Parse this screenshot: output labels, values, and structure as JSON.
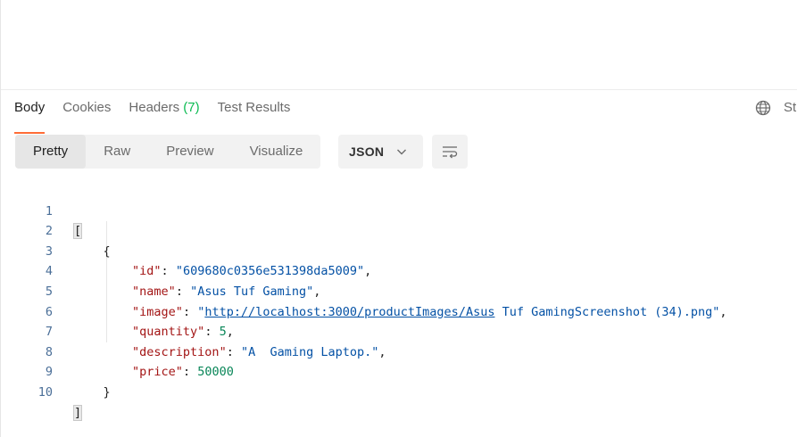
{
  "response_tabs": [
    {
      "label": "Body"
    },
    {
      "label": "Cookies"
    },
    {
      "label": "Headers",
      "count": "(7)"
    },
    {
      "label": "Test Results"
    }
  ],
  "status_cut": "St",
  "view_modes": [
    "Pretty",
    "Raw",
    "Preview",
    "Visualize"
  ],
  "format": "JSON",
  "colors": {
    "active_tab_underline": "#ff6c37",
    "headers_count": "#0cbb52",
    "json_key": "#a31515",
    "json_string": "#0451a5",
    "json_number": "#098658"
  },
  "icons": {
    "globe": "globe-icon",
    "format_dropdown": "chevron-down-icon",
    "wrap": "wrap-lines-icon"
  },
  "code": {
    "line_numbers": [
      "1",
      "2",
      "3",
      "4",
      "5",
      "6",
      "7",
      "8",
      "9",
      "10"
    ],
    "open_bracket": "[",
    "open_brace": "{",
    "id_key": "\"id\"",
    "id_value": "\"609680c0356e531398da5009\"",
    "name_key": "\"name\"",
    "name_value": "\"Asus Tuf Gaming\"",
    "image_key": "\"image\"",
    "image_quote_open": "\"",
    "image_link": "http://localhost:3000/productImages/Asus",
    "image_rest": " Tuf GamingScreenshot (34).png\"",
    "quantity_key": "\"quantity\"",
    "quantity_value": "5",
    "description_key": "\"description\"",
    "description_value": "\"A  Gaming Laptop.\"",
    "price_key": "\"price\"",
    "price_value": "50000",
    "close_brace": "}",
    "close_bracket": "]"
  }
}
